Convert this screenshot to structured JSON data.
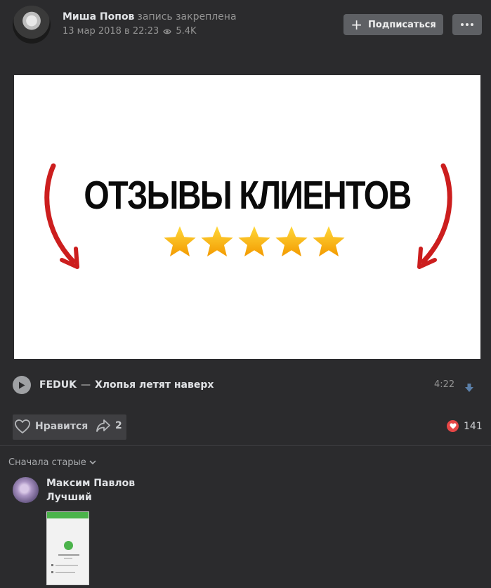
{
  "post": {
    "author_name": "Миша Попов",
    "author_status": "запись закреплена",
    "date": "13 мар 2018 в 22:23",
    "views": "5.4K",
    "subscribe_label": "Подписаться",
    "image": {
      "title": "ОТЗЫВЫ КЛИЕНТОВ",
      "stars": 5
    }
  },
  "audio": {
    "artist": "FEDUK",
    "separator": "—",
    "title": "Хлопья летят наверх",
    "duration": "4:22"
  },
  "actions": {
    "like_label": "Нравится",
    "share_count": "2",
    "reactions_count": "141"
  },
  "comments": {
    "sort_label": "Сначала старые",
    "items": [
      {
        "author": "Максим Павлов",
        "text": "Лучший"
      }
    ]
  },
  "colors": {
    "background": "#2b2b2d",
    "button": "#5e6064",
    "accent_red": "#e64646",
    "star": "#f7b500",
    "arrow": "#cc1e1e"
  }
}
